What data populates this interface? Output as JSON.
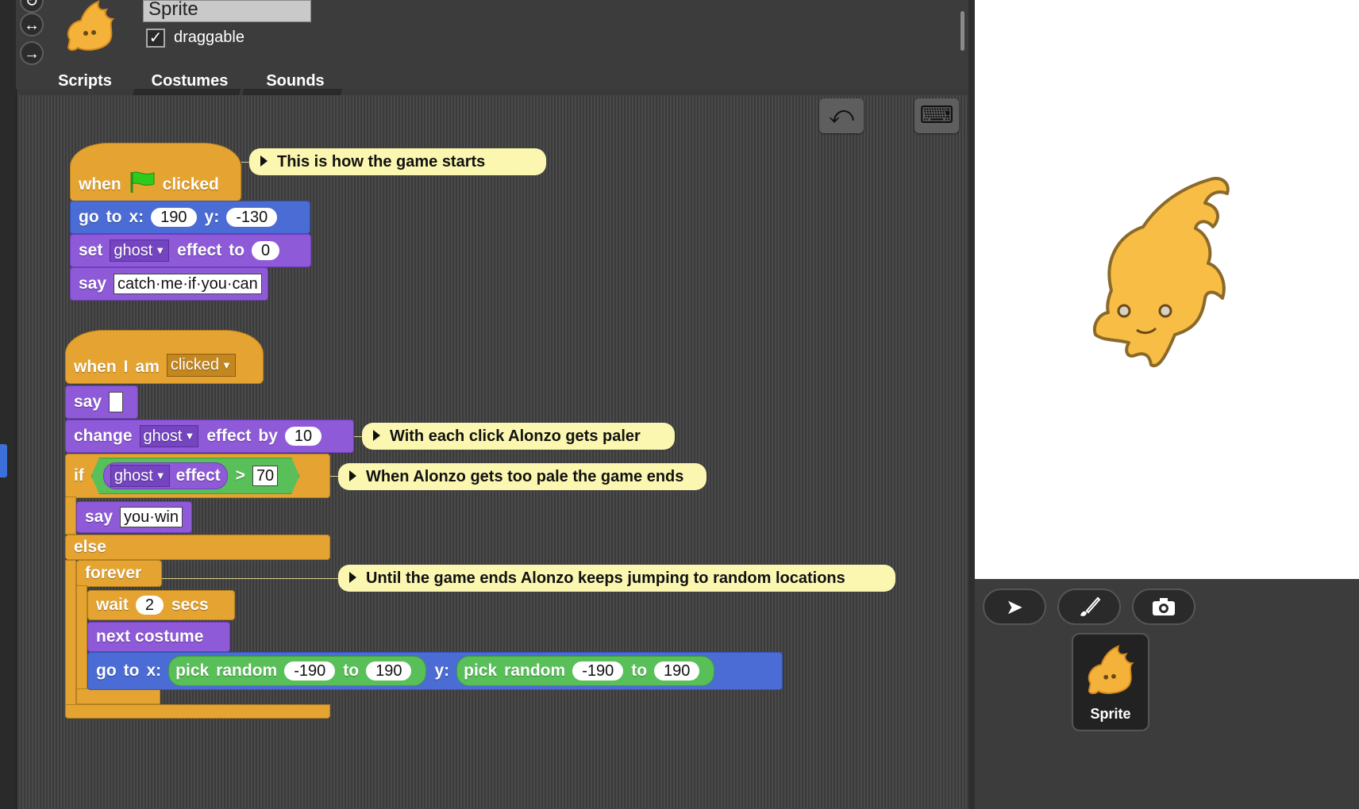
{
  "sprite": {
    "name": "Sprite",
    "draggable_label": "draggable",
    "draggable_checked": "✓"
  },
  "rotation_buttons": [
    "↻",
    "↔",
    "→"
  ],
  "tabs": [
    {
      "label": "Scripts"
    },
    {
      "label": "Costumes"
    },
    {
      "label": "Sounds"
    }
  ],
  "toolbar": {
    "undo_icon": "⤺",
    "keyboard_icon": "⌨"
  },
  "script1": {
    "hat": {
      "when": "when",
      "clicked": "clicked"
    },
    "goto": {
      "go": "go",
      "to": "to",
      "x": "x:",
      "xval": "190",
      "y": "y:",
      "yval": "-130"
    },
    "seteffect": {
      "set": "set",
      "effect": "ghost",
      "effect_to": "effect",
      "to": "to",
      "val": "0"
    },
    "say": {
      "say": "say",
      "text": "catch·me·if·you·can"
    },
    "comment": "This is how the game starts"
  },
  "script2": {
    "hat": {
      "when": "when",
      "i": "I",
      "am": "am",
      "event": "clicked"
    },
    "say": {
      "say": "say",
      "text": ""
    },
    "change": {
      "change": "change",
      "effect": "ghost",
      "effect_word": "effect",
      "by": "by",
      "val": "10"
    },
    "change_comment": "With each click Alonzo gets paler",
    "if": {
      "if": "if",
      "effect": "ghost",
      "effect_word": "effect",
      "gt": ">",
      "val": "70"
    },
    "if_comment": "When Alonzo gets too pale the game ends",
    "saywin": {
      "say": "say",
      "text": "you·win"
    },
    "else": "else",
    "forever": "forever",
    "forever_comment": "Until the game ends Alonzo keeps jumping to random locations",
    "wait": {
      "wait": "wait",
      "val": "2",
      "secs": "secs"
    },
    "nextcostume": "next costume",
    "goto_random": {
      "go": "go",
      "to": "to",
      "x": "x:",
      "y": "y:",
      "pick": "pick",
      "random": "random",
      "to2": "to",
      "min": "-190",
      "max": "190"
    }
  },
  "corral": {
    "buttons": [
      "arrow-icon",
      "brush-icon",
      "camera-icon"
    ],
    "sprite_label": "Sprite"
  },
  "colors": {
    "event": "#e5a431",
    "motion": "#4a6cd4",
    "looks": "#8e5ad8",
    "operators": "#59c059",
    "comment": "#fbf7b0"
  }
}
